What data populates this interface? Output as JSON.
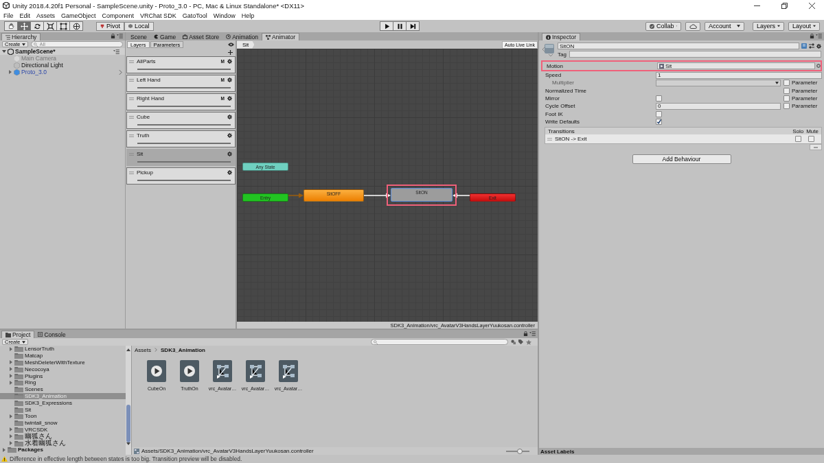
{
  "window": {
    "title": "Unity 2018.4.20f1 Personal - SampleScene.unity - Proto_3.0 - PC, Mac & Linux Standalone* <DX11>"
  },
  "menu": [
    "File",
    "Edit",
    "Assets",
    "GameObject",
    "Component",
    "VRChat SDK",
    "GatoTool",
    "Window",
    "Help"
  ],
  "toolbar": {
    "tools": [
      {
        "kind": "hand",
        "selected": false
      },
      {
        "kind": "move",
        "selected": true
      },
      {
        "kind": "rotate",
        "selected": false
      },
      {
        "kind": "scale",
        "selected": false
      },
      {
        "kind": "rect",
        "selected": false
      },
      {
        "kind": "transform",
        "selected": false
      }
    ],
    "pivot": "Pivot",
    "space": "Local",
    "collab": "Collab",
    "account": "Account",
    "layers": "Layers",
    "layout": "Layout"
  },
  "hierarchy": {
    "tab": "Hierarchy",
    "create": "Create",
    "search_placeholder": "All",
    "scene": {
      "label": "SampleScene*",
      "expanded": true,
      "children": [
        {
          "label": "Main Camera",
          "kind": "object",
          "disabled": true
        },
        {
          "label": "Directional Light",
          "kind": "object",
          "disabled": false
        },
        {
          "label": "Proto_3.0",
          "kind": "prefab",
          "disabled": false,
          "expanded": false
        }
      ]
    }
  },
  "center_tabs": [
    {
      "label": "Scene",
      "kind": "scene",
      "selected": false
    },
    {
      "label": "Game",
      "kind": "game",
      "selected": false
    },
    {
      "label": "Asset Store",
      "kind": "store",
      "selected": false
    },
    {
      "label": "Animation",
      "kind": "animation",
      "selected": false
    },
    {
      "label": "Animator",
      "kind": "animator",
      "selected": true
    }
  ],
  "animator": {
    "subtabs": [
      {
        "label": "Layers",
        "selected": true
      },
      {
        "label": "Parameters",
        "selected": false
      }
    ],
    "layers": [
      {
        "name": "AllParts",
        "badge": "M",
        "level": 1,
        "selected": false
      },
      {
        "name": "Left Hand",
        "badge": "M",
        "level": 1,
        "selected": false
      },
      {
        "name": "Right Hand",
        "badge": "M",
        "level": 1,
        "selected": false
      },
      {
        "name": "Cube",
        "level": 1,
        "selected": false
      },
      {
        "name": "Truth",
        "level": 1,
        "selected": false
      },
      {
        "name": "Sit",
        "level": 1,
        "selected": true
      },
      {
        "name": "Pickup",
        "level": 1,
        "selected": false
      }
    ],
    "breadcrumb": "Sit",
    "live_link": "Auto Live Link",
    "nodes": [
      {
        "label": "Any State",
        "kind": "any",
        "selected": false,
        "highlighted": false
      },
      {
        "label": "Entry",
        "kind": "entry",
        "selected": false,
        "highlighted": false
      },
      {
        "label": "SitOFF",
        "kind": "default",
        "selected": false,
        "highlighted": false
      },
      {
        "label": "SitON",
        "kind": "state",
        "selected": true,
        "highlighted": true
      },
      {
        "label": "Exit",
        "kind": "exit",
        "selected": false,
        "highlighted": false
      }
    ],
    "edges": [
      {
        "kind": "default"
      },
      {
        "kind": "normal"
      },
      {
        "kind": "normal"
      }
    ],
    "controller_path": "SDK3_Animation/vrc_AvatarV3HandsLayerYuukosan.controller"
  },
  "inspector": {
    "tab": "Inspector",
    "name": "SitON",
    "tag_label": "Tag",
    "fields": [
      {
        "kind": "object",
        "label": "Motion",
        "value": "Sit",
        "highlighted": true
      },
      {
        "kind": "text",
        "label": "Speed",
        "value": "1",
        "highlighted": false
      },
      {
        "kind": "dropdown",
        "label": "Multiplier",
        "disabled": true,
        "highlighted": false,
        "parameter": {
          "label": "Parameter",
          "checked": false
        }
      },
      {
        "kind": "none",
        "label": "Normalized Time",
        "highlighted": false,
        "parameter": {
          "label": "Parameter",
          "checked": false
        }
      },
      {
        "kind": "checkbox",
        "label": "Mirror",
        "checked": false,
        "highlighted": false,
        "parameter": {
          "label": "Parameter",
          "checked": false
        }
      },
      {
        "kind": "text",
        "label": "Cycle Offset",
        "value": "0",
        "highlighted": false,
        "parameter": {
          "label": "Parameter",
          "checked": false
        }
      },
      {
        "kind": "checkbox",
        "label": "Foot IK",
        "checked": false,
        "highlighted": false
      },
      {
        "kind": "checkbox",
        "label": "Write Defaults",
        "checked": true,
        "highlighted": false
      }
    ],
    "transitions": {
      "title": "Transitions",
      "solo": "Solo",
      "mute": "Mute",
      "rows": [
        {
          "label": "SitON -> Exit",
          "solo": false,
          "mute": false
        }
      ]
    },
    "add_behaviour": "Add Behaviour",
    "asset_labels": "Asset Labels"
  },
  "project": {
    "tabs": [
      {
        "label": "Project",
        "kind": "project",
        "selected": true
      },
      {
        "label": "Console",
        "kind": "console",
        "selected": false
      }
    ],
    "create": "Create",
    "folders": [
      {
        "label": "LensorTruth",
        "expanded": false,
        "selected": false
      },
      {
        "label": "Matcap",
        "selected": false
      },
      {
        "label": "MeshDeleterWithTexture",
        "expanded": false,
        "selected": false
      },
      {
        "label": "Necocoya",
        "expanded": false,
        "selected": false
      },
      {
        "label": "Plugins",
        "expanded": false,
        "selected": false
      },
      {
        "label": "Ring",
        "expanded": false,
        "selected": false
      },
      {
        "label": "Scenes",
        "selected": false
      },
      {
        "label": "SDK3_Animation",
        "selected": true
      },
      {
        "label": "SDK3_Expressions",
        "selected": false
      },
      {
        "label": "Sit",
        "selected": false
      },
      {
        "label": "Toon",
        "expanded": false,
        "selected": false
      },
      {
        "label": "twintail_snow",
        "selected": false
      },
      {
        "label": "VRCSDK",
        "expanded": false,
        "selected": false
      },
      {
        "label": "幽狐さん",
        "expanded": false,
        "selected": false
      },
      {
        "label": "水着幽狐さん",
        "expanded": false,
        "selected": false
      }
    ],
    "packages": {
      "label": "Packages",
      "expanded": false
    },
    "breadcrumb": [
      "Assets",
      "SDK3_Animation"
    ],
    "assets": [
      {
        "label": "CubeOn",
        "kind": "clip"
      },
      {
        "label": "TruthOn",
        "kind": "clip"
      },
      {
        "label": "vrc_Avatar…",
        "kind": "controller"
      },
      {
        "label": "vrc_Avatar…",
        "kind": "controller"
      },
      {
        "label": "vrc_Avatar…",
        "kind": "controller"
      }
    ],
    "selected_path": "Assets/SDK3_Animation/vrc_AvatarV3HandsLayerYuukosan.controller",
    "icon_size": {
      "level": 0.6
    }
  },
  "status": {
    "kind": "warning",
    "text": "Difference in effective length between states is too big. Transition preview will be disabled."
  }
}
